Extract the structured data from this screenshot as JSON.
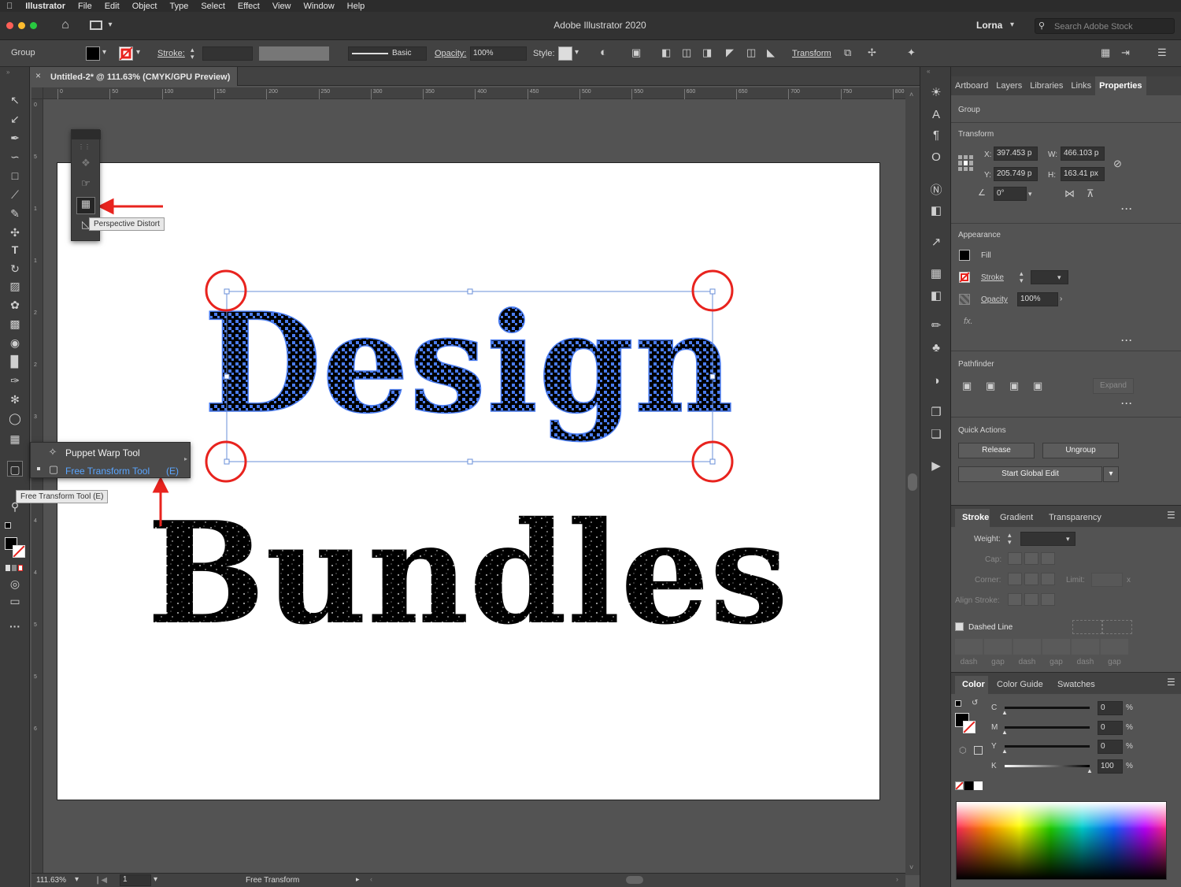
{
  "menubar": {
    "apple_icon": "apple-icon",
    "app": "Illustrator",
    "items": [
      "File",
      "Edit",
      "Object",
      "Type",
      "Select",
      "Effect",
      "View",
      "Window",
      "Help"
    ]
  },
  "titlebar": {
    "title": "Adobe Illustrator 2020",
    "user": "Lorna",
    "search_placeholder": "Search Adobe Stock"
  },
  "control": {
    "selection": "Group",
    "stroke_label": "Stroke:",
    "brush": "Basic",
    "opacity_label": "Opacity:",
    "opacity": "100%",
    "style_label": "Style:",
    "transform_label": "Transform"
  },
  "document": {
    "tab_title": "Untitled-2* @ 111.63% (CMYK/GPU Preview)",
    "ruler_h": [
      "0",
      "50",
      "100",
      "150",
      "200",
      "250",
      "300",
      "350",
      "400",
      "450",
      "500",
      "550",
      "600",
      "650",
      "700",
      "750",
      "800"
    ],
    "ruler_v": [
      "0",
      "5",
      "1",
      "1",
      "2",
      "2",
      "3",
      "3",
      "4",
      "4",
      "5",
      "5",
      "6"
    ]
  },
  "toolbar": {
    "flyout_reshape": {
      "tooltip": "Perspective Distort"
    },
    "flyout_transform": {
      "items": [
        {
          "label": "Puppet Warp Tool",
          "shortcut": ""
        },
        {
          "label": "Free Transform Tool",
          "shortcut": "(E)"
        }
      ],
      "tooltip": "Free Transform Tool (E)"
    }
  },
  "artwork": {
    "line1": "Design",
    "line2": "Bundles"
  },
  "statusbar": {
    "zoom": "111.63%",
    "page": "1",
    "status": "Free Transform"
  },
  "panel": {
    "tabs": [
      "Artboard",
      "Layers",
      "Libraries",
      "Links",
      "Properties"
    ],
    "selection_type": "Group",
    "transform": {
      "title": "Transform",
      "x_label": "X:",
      "x": "397.453 p",
      "y_label": "Y:",
      "y": "205.749 p",
      "w_label": "W:",
      "w": "466.103 p",
      "h_label": "H:",
      "h": "163.41 px",
      "angle": "0°"
    },
    "appearance": {
      "title": "Appearance",
      "fill": "Fill",
      "stroke": "Stroke",
      "opacity_label": "Opacity",
      "opacity": "100%",
      "fx": "fx."
    },
    "pathfinder": {
      "title": "Pathfinder",
      "expand": "Expand"
    },
    "quick_actions": {
      "title": "Quick Actions",
      "release": "Release",
      "ungroup": "Ungroup",
      "start_global_edit": "Start Global Edit"
    },
    "stroke_panel": {
      "tabs": [
        "Stroke",
        "Gradient",
        "Transparency"
      ],
      "weight": "Weight:",
      "cap": "Cap:",
      "corner": "Corner:",
      "limit": "Limit:",
      "limit_x": "x",
      "align": "Align Stroke:",
      "dashed": "Dashed Line",
      "dash_labels": [
        "dash",
        "gap",
        "dash",
        "gap",
        "dash",
        "gap"
      ]
    },
    "color_panel": {
      "tabs": [
        "Color",
        "Color Guide",
        "Swatches"
      ],
      "channels": [
        {
          "name": "C",
          "value": "0"
        },
        {
          "name": "M",
          "value": "0"
        },
        {
          "name": "Y",
          "value": "0"
        },
        {
          "name": "K",
          "value": "100"
        }
      ],
      "percent": "%"
    }
  },
  "colors": {
    "accent_blue": "#4a7cf0",
    "annotation_red": "#e8231e",
    "selection_blue": "#6a8fd8"
  }
}
